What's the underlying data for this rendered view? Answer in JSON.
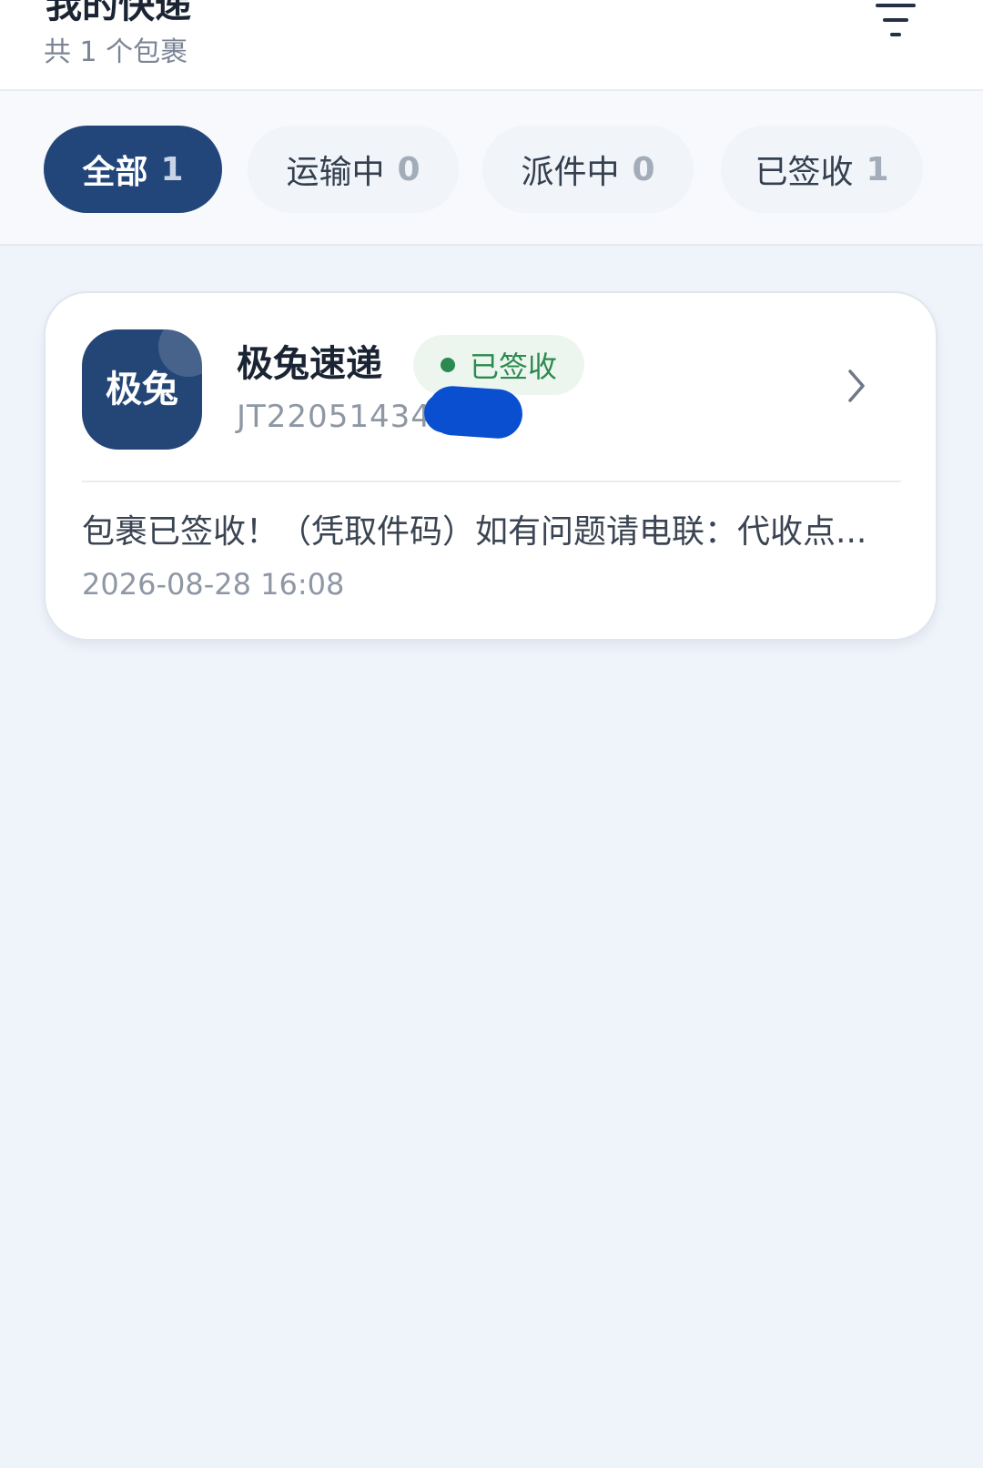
{
  "header": {
    "title": "我的快递",
    "subtitle": "共 1 个包裹",
    "filter_icon": "filter-icon"
  },
  "tabs": [
    {
      "label": "全部",
      "count": "1",
      "active": true
    },
    {
      "label": "运输中",
      "count": "0",
      "active": false
    },
    {
      "label": "派件中",
      "count": "0",
      "active": false
    },
    {
      "label": "已签收",
      "count": "1",
      "active": false
    }
  ],
  "package": {
    "logo_text": "极兔",
    "courier": "极兔速递",
    "status": "已签收",
    "tracking_number_visible": "JT22051434",
    "message": "包裹已签收！（凭取件码）如有问题请电联：代收点...",
    "timestamp": "2026-08-28 16:08"
  },
  "colors": {
    "primary": "#22467a",
    "status_green": "#2b8a4f",
    "background": "#eff4fb",
    "redaction": "#0a4fd0"
  }
}
